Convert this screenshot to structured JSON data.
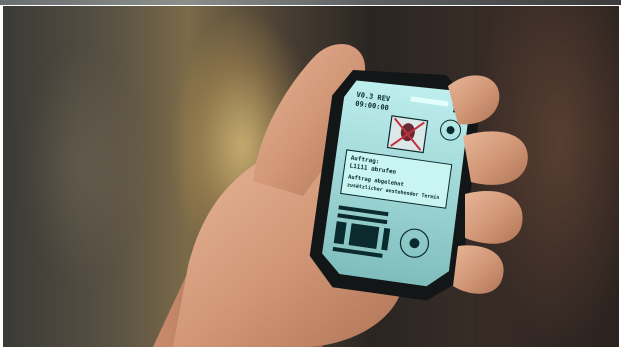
{
  "image": {
    "subject": "hand-holding-handheld-device"
  },
  "device_screen": {
    "header_line_1": "V0.3 REV",
    "header_line_2": "09:00:00",
    "status_icon": "alert-icon",
    "badge_icon": "sunburst-icon",
    "portrait_icon": "crossed-out-portrait-icon",
    "message_label": "Auftrag:",
    "message_line_1": "L1111 abrufen",
    "message_line_2": "Auftrag abgelehnt",
    "message_line_3": "zusätzlicher anstehender Termin",
    "logo_icon": "tmi-logo-icon",
    "colors": {
      "screen": "#9fd7d6",
      "screen_glow": "#c8f4f2",
      "ink": "#0b2a2e",
      "body": "#121617"
    }
  }
}
